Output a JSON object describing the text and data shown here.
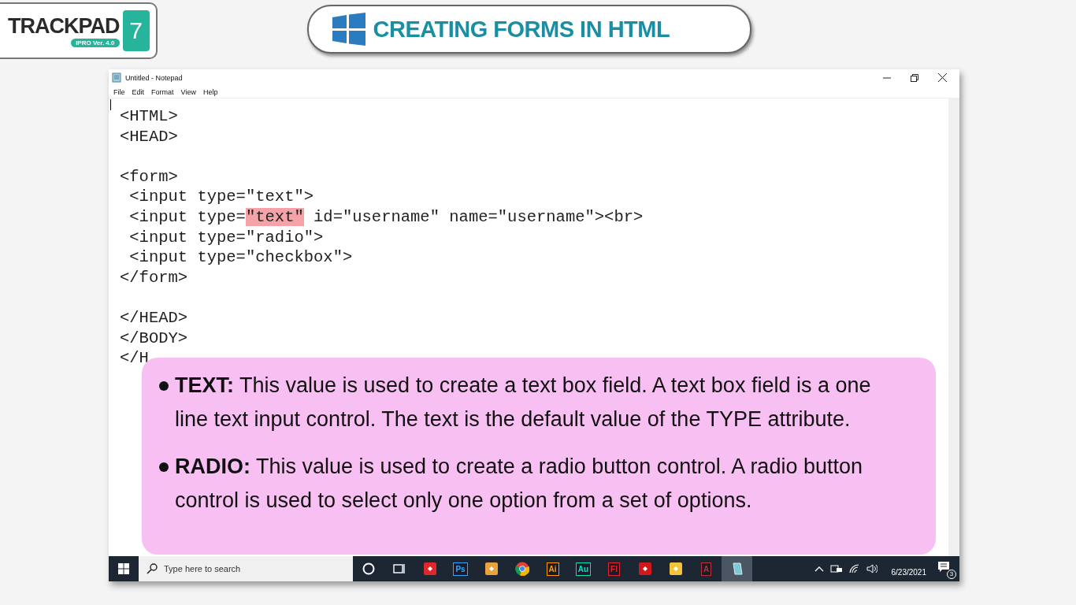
{
  "logo": {
    "wordmark": "TRACKPAD",
    "edition": "IPRO Ver. 4.0",
    "number": "7"
  },
  "banner": {
    "title": "CREATING FORMS IN HTML"
  },
  "window": {
    "title": "Untitled - Notepad",
    "menu": [
      "File",
      "Edit",
      "Format",
      "View",
      "Help"
    ]
  },
  "editor": {
    "lines": [
      {
        "kind": "code",
        "segments": [
          {
            "text": "<HTML>",
            "selected": false
          }
        ]
      },
      {
        "kind": "code",
        "segments": [
          {
            "text": "<HEAD>",
            "selected": false
          }
        ]
      },
      {
        "kind": "blank"
      },
      {
        "kind": "code",
        "segments": [
          {
            "text": "<form>",
            "selected": false
          }
        ]
      },
      {
        "kind": "code",
        "segments": [
          {
            "text": " <input type=\"text\">",
            "selected": false
          }
        ]
      },
      {
        "kind": "code",
        "segments": [
          {
            "text": " <input type=",
            "selected": false
          },
          {
            "text": "\"text\"",
            "selected": true
          },
          {
            "text": " id=\"username\" name=\"username\"><br>",
            "selected": false
          }
        ]
      },
      {
        "kind": "code",
        "segments": [
          {
            "text": " <input type=\"radio\">",
            "selected": false
          }
        ]
      },
      {
        "kind": "code",
        "segments": [
          {
            "text": " <input type=\"checkbox\">",
            "selected": false
          }
        ]
      },
      {
        "kind": "code",
        "segments": [
          {
            "text": "</form>",
            "selected": false
          }
        ]
      },
      {
        "kind": "blank"
      },
      {
        "kind": "code",
        "segments": [
          {
            "text": "</HEAD>",
            "selected": false
          }
        ]
      },
      {
        "kind": "code",
        "segments": [
          {
            "text": "</BODY>",
            "selected": false
          }
        ]
      },
      {
        "kind": "code",
        "segments": [
          {
            "text": "</H",
            "selected": false
          }
        ]
      }
    ]
  },
  "note": {
    "items": [
      {
        "term": "TEXT:",
        "text": "This value is used to create a text box field. A text box field is a one line text input control. The text is the default value of the TYPE attribute."
      },
      {
        "term": "RADIO:",
        "text": "This value is used to create a radio button control. A radio button control is used to select only one option from a set of options."
      }
    ]
  },
  "taskbar": {
    "search_placeholder": "Type here to search",
    "apps": [
      {
        "kind": "cortana"
      },
      {
        "kind": "taskview"
      },
      {
        "kind": "app",
        "color": "#e0282c"
      },
      {
        "kind": "label",
        "label": "Ps",
        "color": "#31a8ff"
      },
      {
        "kind": "app",
        "color": "#e8a33c"
      },
      {
        "kind": "chrome"
      },
      {
        "kind": "label",
        "label": "Ai",
        "color": "#ff9a00"
      },
      {
        "kind": "label",
        "label": "Au",
        "color": "#00e4bb"
      },
      {
        "kind": "label",
        "label": "Fl",
        "color": "#e0262c"
      },
      {
        "kind": "app",
        "color": "#d21919"
      },
      {
        "kind": "app",
        "color": "#f3c33c"
      },
      {
        "kind": "label",
        "label": "A",
        "color": "#b7343a"
      },
      {
        "kind": "notepad"
      }
    ],
    "date": "6/23/2021",
    "notifications": "3"
  }
}
